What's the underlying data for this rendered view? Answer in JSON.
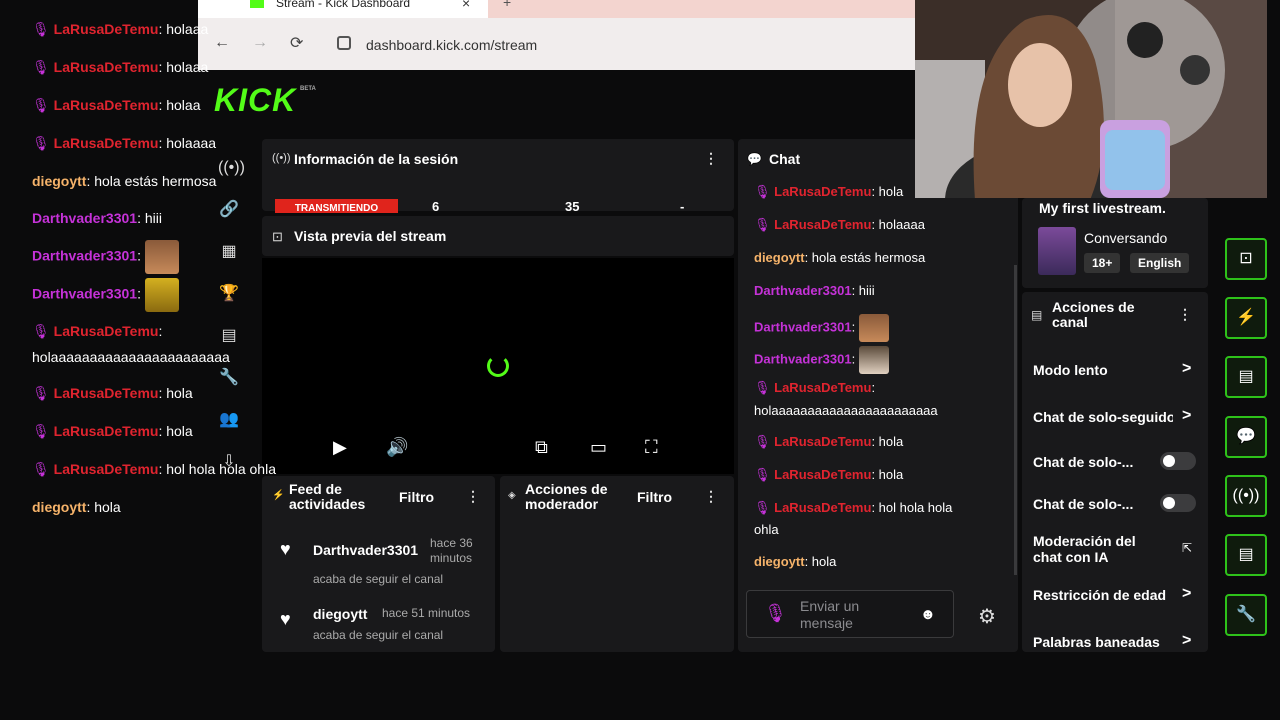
{
  "browser": {
    "tab_title": "Stream - Kick Dashboard",
    "tab_close": "×",
    "tab_new": "+",
    "url": "dashboard.kick.com/stream",
    "back": "←",
    "forward": "→",
    "reload": "⟳"
  },
  "brand": {
    "logo": "KICK",
    "beta": "BETA",
    "accent": "#53fc18"
  },
  "session": {
    "title": "Información de la sesión",
    "status": "TRANSMITIENDO",
    "stat1": "6",
    "stat2": "35",
    "stat3": "-"
  },
  "preview": {
    "title": "Vista previa del stream"
  },
  "feed": {
    "title": "Feed de actividades",
    "filter": "Filtro",
    "items": [
      {
        "name": "Darthvader3301",
        "time": "hace 36 minutos",
        "action": "acaba de seguir el canal"
      },
      {
        "name": "diegoytt",
        "time": "hace 51 minutos",
        "action": "acaba de seguir el canal"
      }
    ]
  },
  "moderator": {
    "title": "Acciones de moderador",
    "filter": "Filtro"
  },
  "chat": {
    "title": "Chat",
    "messages": [
      {
        "user": "LaRusaDeTemu",
        "text": ": hola"
      },
      {
        "user": "LaRusaDeTemu",
        "text": ": holaaaa"
      },
      {
        "user": "diegoytt",
        "text": ": hola estás hermosa"
      },
      {
        "user": "Darthvader3301",
        "text": ": hiii"
      },
      {
        "user": "Darthvader3301",
        "text": ":"
      },
      {
        "user": "Darthvader3301",
        "text": ":"
      },
      {
        "user": "LaRusaDeTemu",
        "text": ":"
      },
      {
        "user": "",
        "text": "holaaaaaaaaaaaaaaaaaaaaaaa"
      },
      {
        "user": "LaRusaDeTemu",
        "text": ": hola"
      },
      {
        "user": "LaRusaDeTemu",
        "text": ": hola"
      },
      {
        "user": "LaRusaDeTemu",
        "text": ": hol hola hola"
      },
      {
        "user": "",
        "text": "ohla"
      },
      {
        "user": "diegoytt",
        "text": ": hola"
      }
    ],
    "input_placeholder": "Enviar un mensaje"
  },
  "stream_info": {
    "title": "My first livestream.",
    "category": "Conversando",
    "tag_age": "18+",
    "tag_lang": "English"
  },
  "channel_actions": {
    "title": "Acciones de canal",
    "items": [
      {
        "label": "Modo lento"
      },
      {
        "label": "Chat de solo-seguidores"
      },
      {
        "label": "Chat de solo-..."
      },
      {
        "label": "Chat de solo-..."
      },
      {
        "label": "Moderación del chat con IA"
      },
      {
        "label": "Restricción de edad"
      },
      {
        "label": "Palabras baneadas"
      }
    ]
  },
  "overlay_chat": [
    {
      "user": "LaRusaDeTemu",
      "text": ": holaaa"
    },
    {
      "user": "LaRusaDeTemu",
      "text": ": holaaa"
    },
    {
      "user": "LaRusaDeTemu",
      "text": ": holaa"
    },
    {
      "user": "LaRusaDeTemu",
      "text": ": holaaaa"
    },
    {
      "user": "diegoytt",
      "text": ": hola estás hermosa"
    },
    {
      "user": "Darthvader3301",
      "text": ": hiii"
    },
    {
      "user": "Darthvader3301",
      "text": ":"
    },
    {
      "user": "Darthvader3301",
      "text": ":"
    },
    {
      "user": "LaRusaDeTemu",
      "text": ":"
    },
    {
      "user": "",
      "text": "holaaaaaaaaaaaaaaaaaaaaaaa"
    },
    {
      "user": "LaRusaDeTemu",
      "text": ": hola"
    },
    {
      "user": "LaRusaDeTemu",
      "text": ": hola"
    },
    {
      "user": "LaRusaDeTemu",
      "text": ": hol hola hola ohla"
    },
    {
      "user": "diegoytt",
      "text": ": hola"
    }
  ],
  "colors": {
    "red_user": "#e0242f",
    "pink_user": "#c532d8",
    "orange_user": "#f6b36a",
    "accent_green": "#53fc18",
    "live_red": "#e0241c"
  },
  "icons": [
    "mic-icon",
    "heart-icon",
    "gear-icon",
    "play-icon",
    "volume-icon",
    "pip-icon",
    "theater-icon",
    "fullscreen-icon",
    "broadcast-icon",
    "link-icon",
    "chart-icon",
    "trophy-icon",
    "wrench-icon",
    "users-icon",
    "chevron-right-icon",
    "emoji-icon"
  ]
}
